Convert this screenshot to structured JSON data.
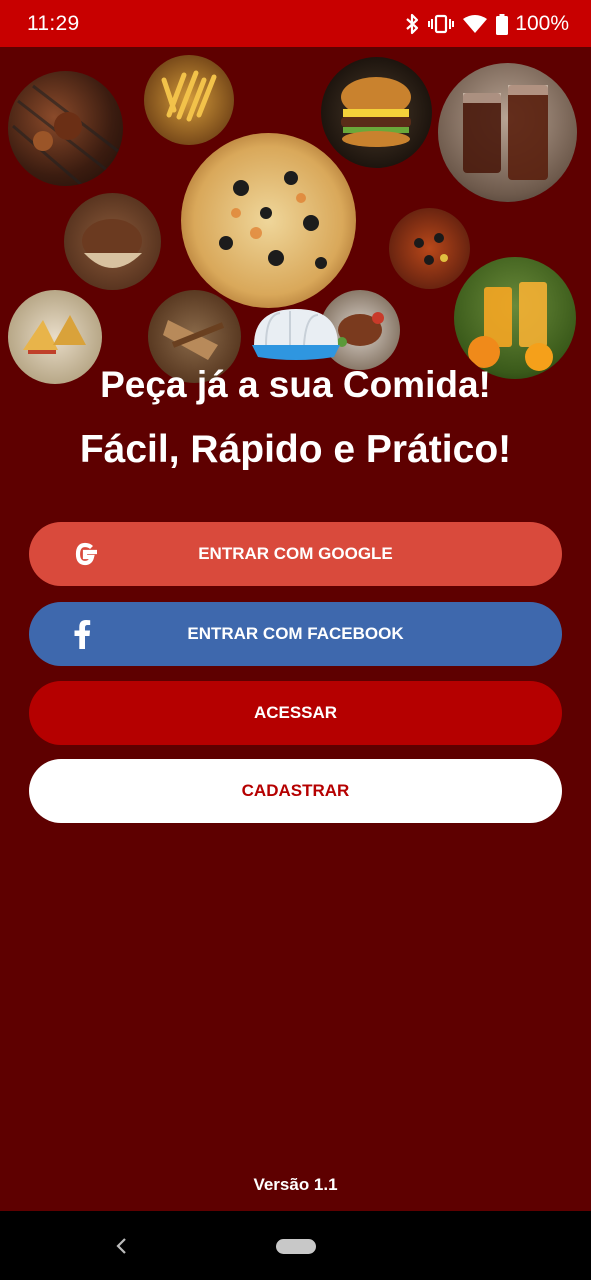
{
  "status_bar": {
    "time": "11:29",
    "battery": "100%",
    "icons": [
      "bluetooth-icon",
      "vibrate-icon",
      "wifi-icon",
      "battery-icon"
    ]
  },
  "header": {
    "collage_items": [
      "grilled-meat",
      "fries",
      "burger",
      "soda",
      "pizza",
      "ice-cream",
      "paella",
      "orange-juice",
      "sandwiches",
      "wraps",
      "steak-plate",
      "chef-hat"
    ],
    "line1": "Peça já a sua Comida!",
    "line2": "Fácil, Rápido e Prático!"
  },
  "actions": {
    "google_label": "ENTRAR COM GOOGLE",
    "facebook_label": "ENTRAR COM FACEBOOK",
    "acessar_label": "ACESSAR",
    "cadastrar_label": "CADASTRAR"
  },
  "footer": {
    "version": "Versão 1.1"
  },
  "colors": {
    "background": "#5e0000",
    "status_bar": "#c80000",
    "google": "#d94a3c",
    "facebook": "#3e68ad",
    "primary": "#b50000",
    "secondary": "#ffffff"
  },
  "nav_bar": {
    "icons": [
      "back-icon",
      "home-pill-icon"
    ]
  }
}
